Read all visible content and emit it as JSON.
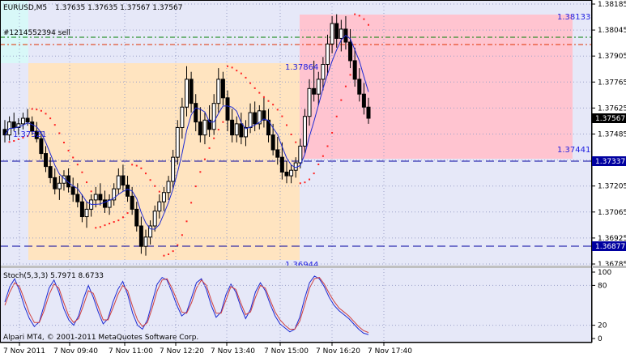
{
  "colors": {
    "background": "#e6e8f8",
    "grid": "#9aa0c8",
    "candle_up": "#000000",
    "candle_down": "#000000",
    "ma_line": "#1e2ad2",
    "sar_dots": "#ff2020",
    "zone_peach": "#ffe4c0",
    "zone_pink": "#ffc4d0",
    "zone_cyan": "#d8f8f8",
    "level_dash": "#0000a0",
    "trade_green": "#008000",
    "trade_red": "#e03000",
    "price_box": "#000000",
    "stoch_main": "#1e2ad2",
    "stoch_signal": "#d04040",
    "axis_text": "#000000",
    "zone_label": "#2020e0"
  },
  "header": {
    "symbol_line": "EURUSD,M5",
    "ohlc": "1.37635 1.37635 1.37567 1.37567",
    "trade_label": "#1214552394 sell"
  },
  "zone_labels": {
    "peach_high": "1.37864",
    "peach_mid": "1.37521",
    "peach_low": "1.36944",
    "pink_high": "1.38133",
    "pink_low": "1.37441"
  },
  "price_axis": {
    "ticks": [
      "1.38185",
      "1.38045",
      "1.37905",
      "1.37765",
      "1.37625",
      "1.37485",
      "1.37345",
      "1.37205",
      "1.37065",
      "1.36925",
      "1.36785"
    ],
    "current_price": "1.37567",
    "level_upper": "1.37337",
    "level_lower": "1.36877"
  },
  "stoch": {
    "label": "Stoch(5,3,3) 5.7971 8.6733",
    "ticks": [
      "100",
      "80",
      "20",
      "0"
    ],
    "copyright": "Alpari MT4, © 2001-2011 MetaQuotes Software Corp."
  },
  "time_axis": {
    "ticks": [
      "7 Nov 2011",
      "7 Nov 09:40",
      "7 Nov 11:00",
      "7 Nov 12:20",
      "7 Nov 13:40",
      "7 Nov 15:00",
      "7 Nov 16:20",
      "7 Nov 17:40"
    ]
  },
  "chart_data": {
    "type": "candlestick",
    "symbol": "EURUSD,M5",
    "ylim": [
      1.3677,
      1.382
    ],
    "candles": [
      [
        1.3751,
        1.3756,
        1.3744,
        1.3748
      ],
      [
        1.3748,
        1.3758,
        1.3745,
        1.3755
      ],
      [
        1.3755,
        1.376,
        1.375,
        1.3752
      ],
      [
        1.3752,
        1.3757,
        1.3748,
        1.3754
      ],
      [
        1.3754,
        1.376,
        1.3751,
        1.3757
      ],
      [
        1.3757,
        1.3762,
        1.3753,
        1.3755
      ],
      [
        1.3755,
        1.3758,
        1.3748,
        1.375
      ],
      [
        1.375,
        1.3755,
        1.3744,
        1.3746
      ],
      [
        1.3746,
        1.375,
        1.3735,
        1.3738
      ],
      [
        1.3738,
        1.3742,
        1.3728,
        1.3731
      ],
      [
        1.3731,
        1.3736,
        1.3722,
        1.3725
      ],
      [
        1.3725,
        1.373,
        1.3716,
        1.3719
      ],
      [
        1.3719,
        1.3726,
        1.3713,
        1.3722
      ],
      [
        1.3722,
        1.3729,
        1.3718,
        1.3726
      ],
      [
        1.3726,
        1.373,
        1.3717,
        1.372
      ],
      [
        1.372,
        1.3725,
        1.3712,
        1.3716
      ],
      [
        1.3716,
        1.3722,
        1.3709,
        1.3712
      ],
      [
        1.3712,
        1.3716,
        1.3701,
        1.3704
      ],
      [
        1.3704,
        1.3712,
        1.3698,
        1.3708
      ],
      [
        1.3708,
        1.3716,
        1.3704,
        1.3713
      ],
      [
        1.3713,
        1.372,
        1.3709,
        1.3716
      ],
      [
        1.3716,
        1.3722,
        1.371,
        1.3713
      ],
      [
        1.3713,
        1.3718,
        1.3706,
        1.3709
      ],
      [
        1.3709,
        1.3716,
        1.3705,
        1.3713
      ],
      [
        1.3713,
        1.3722,
        1.371,
        1.3719
      ],
      [
        1.3719,
        1.373,
        1.3716,
        1.3726
      ],
      [
        1.3726,
        1.3732,
        1.3718,
        1.3721
      ],
      [
        1.3721,
        1.3726,
        1.3712,
        1.3715
      ],
      [
        1.3715,
        1.372,
        1.3705,
        1.3708
      ],
      [
        1.3708,
        1.3712,
        1.3696,
        1.3699
      ],
      [
        1.3699,
        1.3704,
        1.3684,
        1.3688
      ],
      [
        1.3688,
        1.3697,
        1.3683,
        1.3693
      ],
      [
        1.3693,
        1.3702,
        1.3689,
        1.3699
      ],
      [
        1.3699,
        1.371,
        1.3696,
        1.3707
      ],
      [
        1.3707,
        1.3716,
        1.3703,
        1.3712
      ],
      [
        1.3712,
        1.372,
        1.3707,
        1.3717
      ],
      [
        1.3717,
        1.3726,
        1.3713,
        1.3723
      ],
      [
        1.3723,
        1.374,
        1.3719,
        1.3736
      ],
      [
        1.3736,
        1.3756,
        1.3732,
        1.3752
      ],
      [
        1.3752,
        1.3768,
        1.3746,
        1.3763
      ],
      [
        1.3763,
        1.3785,
        1.3758,
        1.3778
      ],
      [
        1.3778,
        1.3782,
        1.376,
        1.3765
      ],
      [
        1.3765,
        1.377,
        1.375,
        1.3755
      ],
      [
        1.3755,
        1.3763,
        1.3744,
        1.3748
      ],
      [
        1.3748,
        1.376,
        1.3743,
        1.3756
      ],
      [
        1.3756,
        1.3764,
        1.3747,
        1.3751
      ],
      [
        1.3751,
        1.377,
        1.3748,
        1.3765
      ],
      [
        1.3765,
        1.3784,
        1.376,
        1.3778
      ],
      [
        1.3778,
        1.3782,
        1.3764,
        1.3768
      ],
      [
        1.3768,
        1.3772,
        1.375,
        1.3756
      ],
      [
        1.3756,
        1.3762,
        1.3744,
        1.3748
      ],
      [
        1.3748,
        1.3758,
        1.3744,
        1.3754
      ],
      [
        1.3754,
        1.376,
        1.3743,
        1.3747
      ],
      [
        1.3747,
        1.3756,
        1.3742,
        1.3752
      ],
      [
        1.3752,
        1.3765,
        1.3749,
        1.376
      ],
      [
        1.376,
        1.3766,
        1.375,
        1.3754
      ],
      [
        1.3754,
        1.3764,
        1.3751,
        1.3761
      ],
      [
        1.3761,
        1.3768,
        1.3752,
        1.3756
      ],
      [
        1.3756,
        1.3762,
        1.3744,
        1.3748
      ],
      [
        1.3748,
        1.3754,
        1.3737,
        1.374
      ],
      [
        1.374,
        1.3747,
        1.3732,
        1.3736
      ],
      [
        1.3736,
        1.3744,
        1.3724,
        1.3728
      ],
      [
        1.3728,
        1.3734,
        1.3722,
        1.3726
      ],
      [
        1.3726,
        1.3732,
        1.3722,
        1.3729
      ],
      [
        1.3729,
        1.3736,
        1.3725,
        1.3733
      ],
      [
        1.3733,
        1.3746,
        1.373,
        1.3742
      ],
      [
        1.3742,
        1.3762,
        1.3738,
        1.3758
      ],
      [
        1.3758,
        1.3778,
        1.3753,
        1.3773
      ],
      [
        1.3773,
        1.3788,
        1.3766,
        1.377
      ],
      [
        1.377,
        1.3782,
        1.3764,
        1.3778
      ],
      [
        1.3778,
        1.379,
        1.3772,
        1.3786
      ],
      [
        1.3786,
        1.3802,
        1.378,
        1.3797
      ],
      [
        1.3797,
        1.3812,
        1.3792,
        1.3808
      ],
      [
        1.3808,
        1.3813,
        1.3795,
        1.38
      ],
      [
        1.38,
        1.381,
        1.3793,
        1.3805
      ],
      [
        1.3805,
        1.3812,
        1.3794,
        1.3798
      ],
      [
        1.3798,
        1.3805,
        1.3784,
        1.3788
      ],
      [
        1.3788,
        1.3795,
        1.3774,
        1.3778
      ],
      [
        1.3778,
        1.3784,
        1.3766,
        1.377
      ],
      [
        1.377,
        1.3776,
        1.3759,
        1.3763
      ],
      [
        1.3763,
        1.3768,
        1.3754,
        1.3757
      ]
    ],
    "stochastic": {
      "main": [
        55,
        78,
        90,
        72,
        48,
        30,
        18,
        25,
        50,
        76,
        88,
        70,
        45,
        28,
        20,
        34,
        60,
        80,
        62,
        40,
        22,
        30,
        55,
        74,
        86,
        66,
        38,
        20,
        14,
        28,
        55,
        82,
        92,
        88,
        70,
        50,
        34,
        40,
        62,
        84,
        90,
        74,
        50,
        32,
        40,
        66,
        82,
        70,
        48,
        30,
        44,
        70,
        84,
        72,
        52,
        34,
        22,
        16,
        10,
        14,
        32,
        60,
        84,
        94,
        90,
        78,
        62,
        50,
        42,
        36,
        30,
        22,
        14,
        8,
        6
      ],
      "signal": [
        50,
        70,
        84,
        78,
        58,
        38,
        24,
        24,
        42,
        66,
        82,
        76,
        54,
        34,
        24,
        30,
        50,
        72,
        68,
        48,
        28,
        28,
        46,
        66,
        80,
        72,
        48,
        28,
        18,
        24,
        46,
        72,
        88,
        90,
        76,
        58,
        40,
        38,
        54,
        76,
        88,
        80,
        58,
        38,
        38,
        58,
        78,
        74,
        54,
        36,
        40,
        62,
        80,
        76,
        58,
        40,
        28,
        20,
        14,
        14,
        26,
        50,
        76,
        90,
        92,
        82,
        68,
        56,
        46,
        40,
        34,
        26,
        18,
        12,
        9
      ]
    }
  }
}
